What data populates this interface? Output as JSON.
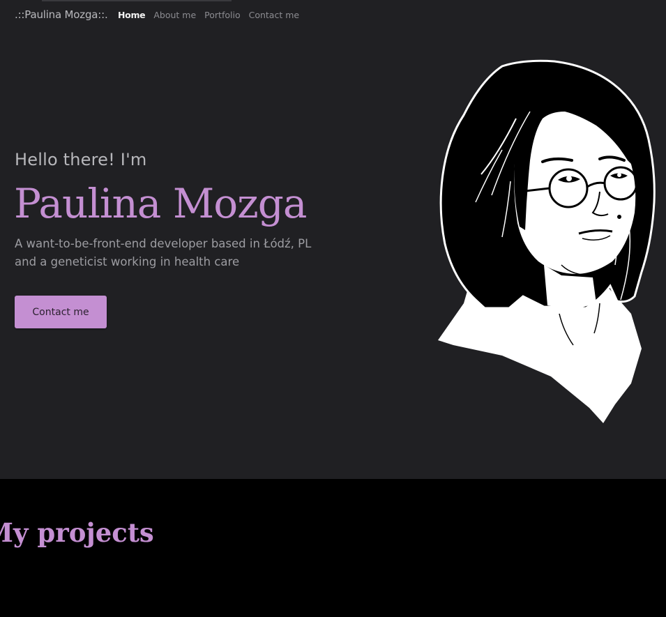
{
  "nav": {
    "brand": ".::Paulina Mozga::.",
    "links": [
      {
        "label": "Home",
        "active": true
      },
      {
        "label": "About me"
      },
      {
        "label": "Portfolio"
      },
      {
        "label": "Contact me"
      }
    ]
  },
  "hero": {
    "greeting": "Hello there! I'm",
    "name": "Paulina Mozga",
    "tagline_line1": "A want-to-be-front-end developer based in Łódź, PL",
    "tagline_line2": "and a geneticist working in health care",
    "cta_label": "Contact me",
    "portrait_icon": "portrait-illustration"
  },
  "projects": {
    "title": "My projects"
  },
  "colors": {
    "accent": "#c48fd2",
    "hero_bg": "#202023",
    "page_bg": "#000000"
  }
}
